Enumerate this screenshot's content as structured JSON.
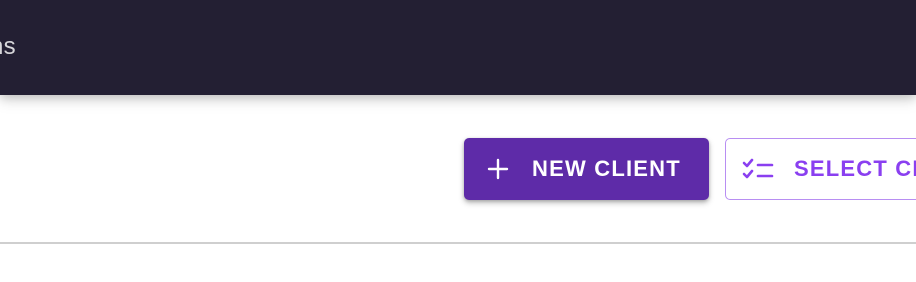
{
  "topbar": {
    "title": "ns"
  },
  "toolbar": {
    "new_client_label": "NEW CLIENT",
    "new_client_icon": "plus-icon",
    "select_label": "SELECT CL",
    "select_icon": "checklist-icon"
  },
  "colors": {
    "topbar_bg": "#231f33",
    "primary_accent": "#5e2ba8",
    "outlined_text": "#8a3ff0",
    "outlined_border": "#b88ef2",
    "divider": "#cfcfcf"
  }
}
